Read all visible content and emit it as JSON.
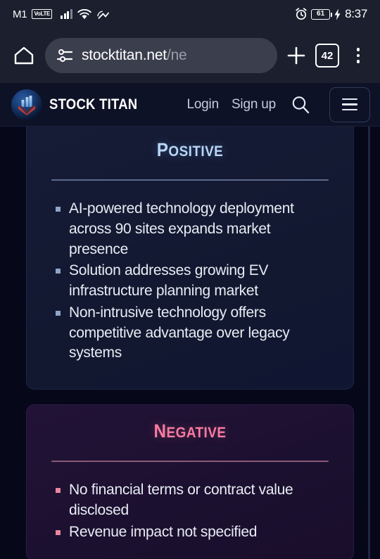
{
  "status_bar": {
    "carrier": "M1",
    "volte_badge": "VoLTE",
    "battery_percent": "61",
    "time": "8:37",
    "icons": [
      "signal-bars-icon",
      "wifi-icon",
      "wifi-calling-icon",
      "alarm-clock-icon",
      "battery-icon",
      "charging-bolt-icon"
    ]
  },
  "browser": {
    "home_icon": "home-icon",
    "site_settings_icon": "tune-icon",
    "url_main": "stocktitan.net",
    "url_dim": "/ne",
    "new_tab_icon": "plus-icon",
    "tab_count": "42",
    "menu_icon": "three-dot-menu-icon"
  },
  "site_header": {
    "brand_name": "STOCK TITAN",
    "logo_icon": "stock-titan-logo-icon",
    "login_label": "Login",
    "signup_label": "Sign up",
    "search_icon": "search-icon",
    "menu_icon": "hamburger-menu-icon"
  },
  "positive_card": {
    "title_first": "P",
    "title_rest": "OSITIVE",
    "bullets": [
      "AI-powered technology deployment across 90 sites expands market presence",
      "Solution addresses growing EV infrastructure planning market",
      "Non-intrusive technology offers competitive advantage over legacy systems"
    ],
    "accent_color": "#b9d6f5"
  },
  "negative_card": {
    "title_first": "N",
    "title_rest": "EGATIVE",
    "bullets": [
      "No financial terms or contract value disclosed",
      "Revenue impact not specified"
    ],
    "accent_color": "#f87ca0"
  }
}
